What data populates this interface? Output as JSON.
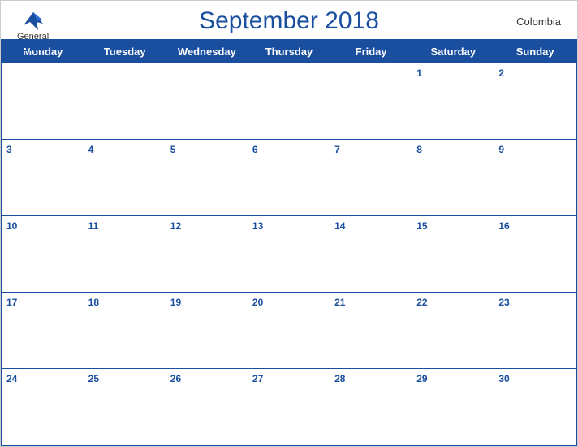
{
  "header": {
    "logo": {
      "general": "General",
      "blue": "Blue",
      "bird_color": "#1a4fa0"
    },
    "title": "September 2018",
    "country": "Colombia"
  },
  "calendar": {
    "weekdays": [
      "Monday",
      "Tuesday",
      "Wednesday",
      "Thursday",
      "Friday",
      "Saturday",
      "Sunday"
    ],
    "weeks": [
      [
        null,
        null,
        null,
        null,
        null,
        "1",
        "2"
      ],
      [
        "3",
        "4",
        "5",
        "6",
        "7",
        "8",
        "9"
      ],
      [
        "10",
        "11",
        "12",
        "13",
        "14",
        "15",
        "16"
      ],
      [
        "17",
        "18",
        "19",
        "20",
        "21",
        "22",
        "23"
      ],
      [
        "24",
        "25",
        "26",
        "27",
        "28",
        "29",
        "30"
      ]
    ]
  }
}
